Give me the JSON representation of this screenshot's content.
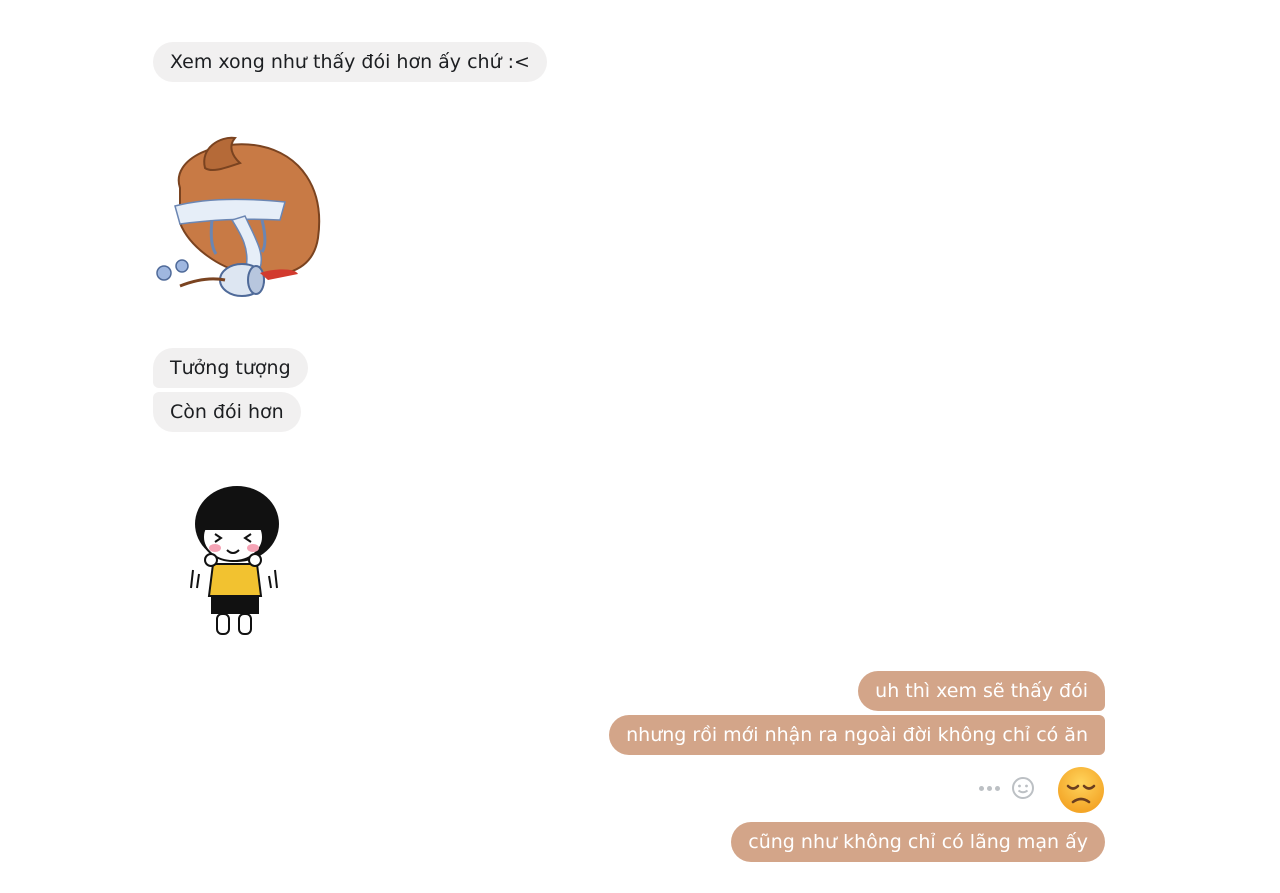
{
  "incoming": {
    "msg_1": "Xem xong như thấy đói hơn ấy chứ :<",
    "msg_2": "Tưởng tượng",
    "msg_3": "Còn đói hơn"
  },
  "stickers": {
    "sticker_1": "crying-poop-toilet-paper-sticker",
    "sticker_2": "shy-girl-sticker"
  },
  "outgoing": {
    "msg_1": "uh thì xem sẽ thấy đói",
    "msg_2": "nhưng rồi mới nhận ra ngoài đời không chỉ có ăn",
    "emoji": "disappointed-face-emoji",
    "msg_3": "cũng như không chỉ có lãng mạn ấy"
  },
  "message_actions": {
    "more_icon": "more-dots-icon",
    "react_icon": "smiley-react-icon"
  },
  "colors": {
    "incoming_bubble": "#f1f0f0",
    "outgoing_bubble": "#d3a589",
    "outgoing_text": "#ffffff"
  }
}
